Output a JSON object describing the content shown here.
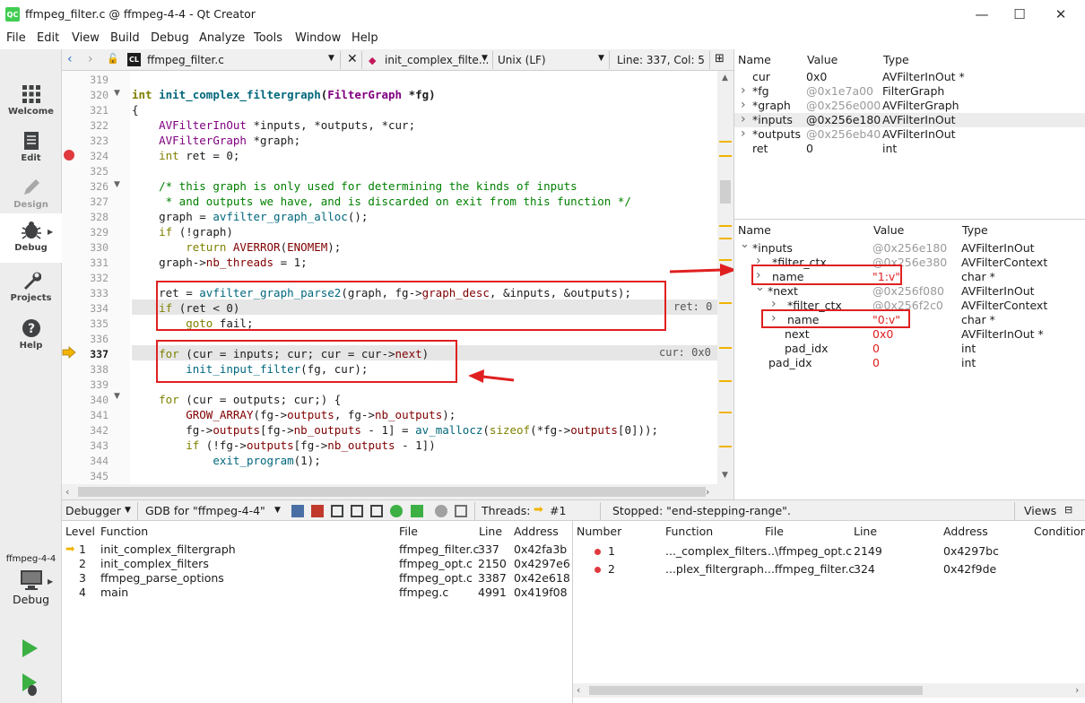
{
  "window": {
    "title": "ffmpeg_filter.c @ ffmpeg-4-4 - Qt Creator",
    "logo": "QC",
    "minimize": "—",
    "maximize": "☐",
    "close": "✕"
  },
  "menu": [
    "File",
    "Edit",
    "View",
    "Build",
    "Debug",
    "Analyze",
    "Tools",
    "Window",
    "Help"
  ],
  "modes": [
    {
      "label": "Welcome",
      "icon": "grid-icon"
    },
    {
      "label": "Edit",
      "icon": "document-icon"
    },
    {
      "label": "Design",
      "icon": "pencil-icon"
    },
    {
      "label": "Debug",
      "icon": "bug-icon"
    },
    {
      "label": "Projects",
      "icon": "wrench-icon"
    },
    {
      "label": "Help",
      "icon": "question-icon"
    }
  ],
  "kit": {
    "project": "ffmpeg-4-4",
    "label": "Debug"
  },
  "editor_toolbar": {
    "file": "ffmpeg_filter.c",
    "file_badge": "CL",
    "symbol": "init_complex_filte...",
    "line_endings": "Unix (LF)",
    "position": "Line: 337, Col: 5"
  },
  "code": {
    "current_line": 337,
    "breakpoint_line": 324,
    "lines": [
      {
        "n": "319",
        "text": ""
      },
      {
        "n": "320",
        "text": "int init_complex_filtergraph(FilterGraph *fg)"
      },
      {
        "n": "321",
        "text": "{"
      },
      {
        "n": "322",
        "text": "    AVFilterInOut *inputs, *outputs, *cur;"
      },
      {
        "n": "323",
        "text": "    AVFilterGraph *graph;"
      },
      {
        "n": "324",
        "text": "    int ret = 0;"
      },
      {
        "n": "325",
        "text": ""
      },
      {
        "n": "326",
        "text": "    /* this graph is only used for determining the kinds of inputs"
      },
      {
        "n": "327",
        "text": "     * and outputs we have, and is discarded on exit from this function */"
      },
      {
        "n": "328",
        "text": "    graph = avfilter_graph_alloc();"
      },
      {
        "n": "329",
        "text": "    if (!graph)"
      },
      {
        "n": "330",
        "text": "        return AVERROR(ENOMEM);"
      },
      {
        "n": "331",
        "text": "    graph->nb_threads = 1;"
      },
      {
        "n": "332",
        "text": ""
      },
      {
        "n": "333",
        "text": "    ret = avfilter_graph_parse2(graph, fg->graph_desc, &inputs, &outputs);"
      },
      {
        "n": "334",
        "text": "    if (ret < 0)"
      },
      {
        "n": "335",
        "text": "        goto fail;"
      },
      {
        "n": "336",
        "text": ""
      },
      {
        "n": "337",
        "text": "    for (cur = inputs; cur; cur = cur->next)"
      },
      {
        "n": "338",
        "text": "        init_input_filter(fg, cur);"
      },
      {
        "n": "339",
        "text": ""
      },
      {
        "n": "340",
        "text": "    for (cur = outputs; cur;) {"
      },
      {
        "n": "341",
        "text": "        GROW_ARRAY(fg->outputs, fg->nb_outputs);"
      },
      {
        "n": "342",
        "text": "        fg->outputs[fg->nb_outputs - 1] = av_mallocz(sizeof(*fg->outputs[0]));"
      },
      {
        "n": "343",
        "text": "        if (!fg->outputs[fg->nb_outputs - 1])"
      },
      {
        "n": "344",
        "text": "            exit_program(1);"
      },
      {
        "n": "345",
        "text": ""
      }
    ],
    "inline_values": {
      "ret": "ret: 0",
      "cur": "cur: 0x0"
    }
  },
  "locals": {
    "headers": [
      "Name",
      "Value",
      "Type"
    ],
    "rows": [
      {
        "name": "cur",
        "value": "0x0",
        "type": "AVFilterInOut *",
        "expandable": false,
        "dim": false
      },
      {
        "name": "*fg",
        "value": "@0x1e7a00",
        "type": "FilterGraph",
        "expandable": true,
        "dim": true
      },
      {
        "name": "*graph",
        "value": "@0x256e000",
        "type": "AVFilterGraph",
        "expandable": true,
        "dim": true
      },
      {
        "name": "*inputs",
        "value": "@0x256e180",
        "type": "AVFilterInOut",
        "expandable": true,
        "dim": false
      },
      {
        "name": "*outputs",
        "value": "@0x256eb40",
        "type": "AVFilterInOut",
        "expandable": true,
        "dim": true
      },
      {
        "name": "ret",
        "value": "0",
        "type": "int",
        "expandable": false,
        "dim": false
      }
    ]
  },
  "watch": {
    "headers": [
      "Name",
      "Value",
      "Type"
    ],
    "rows": [
      {
        "name": "*inputs",
        "value": "@0x256e180",
        "type": "AVFilterInOut",
        "indent": 0,
        "chev": "open",
        "vcolor": "gray"
      },
      {
        "name": "*filter_ctx",
        "value": "@0x256e380",
        "type": "AVFilterContext",
        "indent": 1,
        "chev": "closed",
        "vcolor": "gray"
      },
      {
        "name": "name",
        "value": "\"1:v\"",
        "type": "char *",
        "indent": 1,
        "chev": "closed",
        "vcolor": "red"
      },
      {
        "name": "*next",
        "value": "@0x256f080",
        "type": "AVFilterInOut",
        "indent": 1,
        "chev": "open",
        "vcolor": "gray"
      },
      {
        "name": "*filter_ctx",
        "value": "@0x256f2c0",
        "type": "AVFilterContext",
        "indent": 2,
        "chev": "closed",
        "vcolor": "gray"
      },
      {
        "name": "name",
        "value": "\"0:v\"",
        "type": "char *",
        "indent": 2,
        "chev": "closed",
        "vcolor": "red"
      },
      {
        "name": "next",
        "value": "0x0",
        "type": "AVFilterInOut *",
        "indent": 2,
        "chev": "none",
        "vcolor": "red"
      },
      {
        "name": "pad_idx",
        "value": "0",
        "type": "int",
        "indent": 2,
        "chev": "none",
        "vcolor": "red"
      },
      {
        "name": "pad_idx",
        "value": "0",
        "type": "int",
        "indent": 1,
        "chev": "none",
        "vcolor": "red"
      }
    ]
  },
  "debug_toolbar": {
    "debugger": "Debugger",
    "engine": "GDB for \"ffmpeg-4-4\"",
    "threads_label": "Threads:",
    "thread": "#1",
    "status": "Stopped: \"end-stepping-range\".",
    "views": "Views"
  },
  "stack": {
    "headers": [
      "Level",
      "Function",
      "File",
      "Line",
      "Address"
    ],
    "rows": [
      {
        "level": "1",
        "function": "init_complex_filtergraph",
        "file": "ffmpeg_filter.c",
        "line": "337",
        "address": "0x42fa3b",
        "current": true
      },
      {
        "level": "2",
        "function": "init_complex_filters",
        "file": "ffmpeg_opt.c",
        "line": "2150",
        "address": "0x4297e6",
        "current": false
      },
      {
        "level": "3",
        "function": "ffmpeg_parse_options",
        "file": "ffmpeg_opt.c",
        "line": "3387",
        "address": "0x42e618",
        "current": false
      },
      {
        "level": "4",
        "function": "main",
        "file": "ffmpeg.c",
        "line": "4991",
        "address": "0x419f08",
        "current": false
      }
    ]
  },
  "breakpoints": {
    "headers": [
      "Number",
      "Function",
      "File",
      "Line",
      "Address",
      "Condition"
    ],
    "rows": [
      {
        "number": "1",
        "function": "..._complex_filters",
        "file": "...\\ffmpeg_opt.c",
        "line": "2149",
        "address": "0x4297bc"
      },
      {
        "number": "2",
        "function": "...plex_filtergraph",
        "file": "...ffmpeg_filter.c",
        "line": "324",
        "address": "0x42f9de"
      }
    ]
  },
  "colors": {
    "accent_red": "#e02020",
    "breakpoint": "#e0393e",
    "arrow": "#f0b400"
  }
}
